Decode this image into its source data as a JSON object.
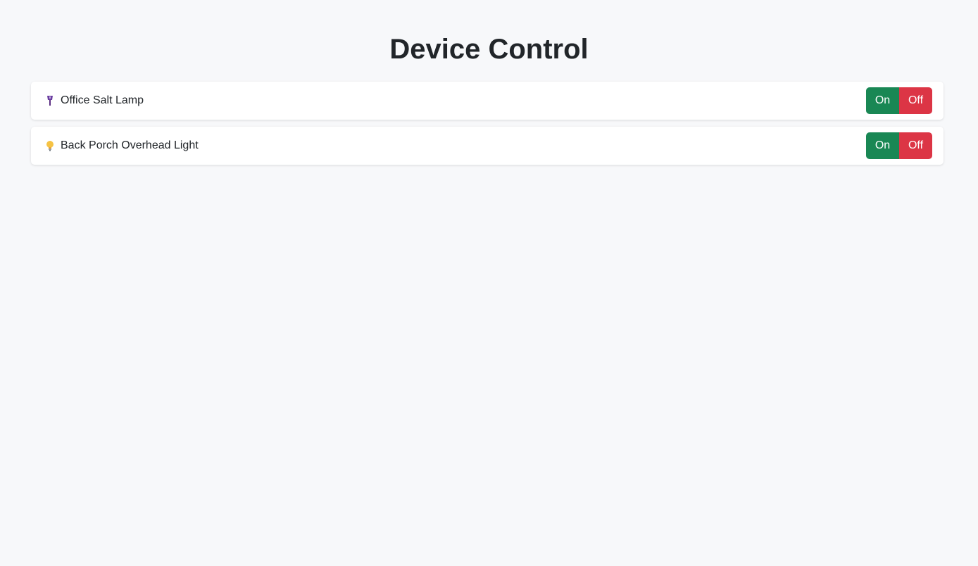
{
  "page": {
    "title": "Device Control"
  },
  "devices": [
    {
      "icon": "salt-lamp-icon",
      "name": "Office Salt Lamp",
      "on_label": "On",
      "off_label": "Off"
    },
    {
      "icon": "light-bulb-icon",
      "name": "Back Porch Overhead Light",
      "on_label": "On",
      "off_label": "Off"
    }
  ],
  "colors": {
    "background": "#f7f8fa",
    "on_button": "#198754",
    "off_button": "#dc3545"
  }
}
